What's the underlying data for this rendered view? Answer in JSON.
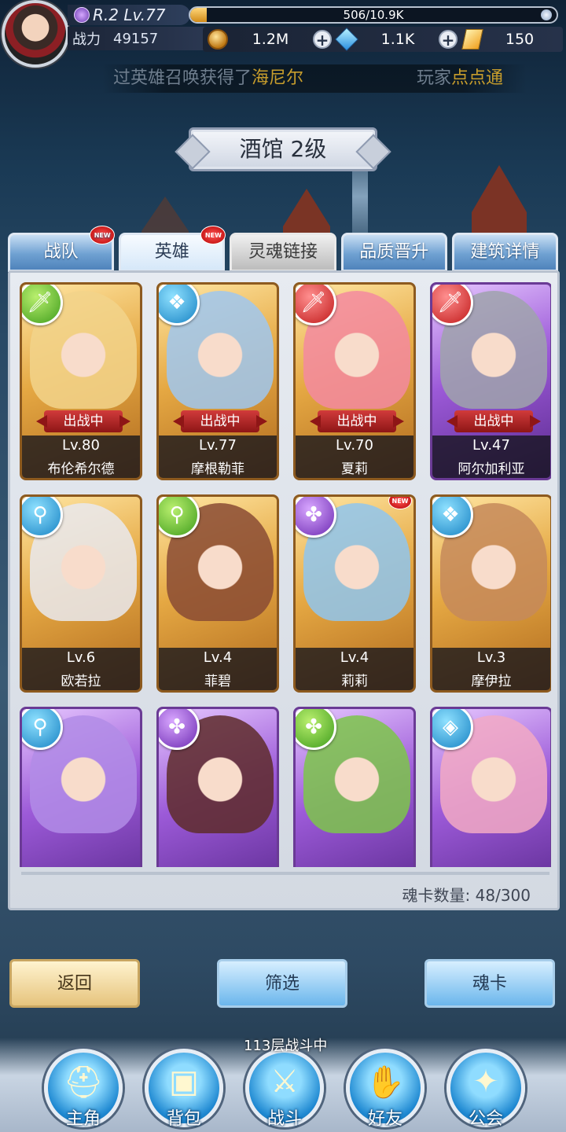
{
  "player": {
    "rank_level": "R.2 Lv.77",
    "exp": "506/10.9K",
    "exp_fraction": 0.046,
    "power_label": "战力",
    "power_value": "49157"
  },
  "resources": {
    "gold": "1.2M",
    "crystal": "1.1K",
    "ticket": "150"
  },
  "marquee": {
    "msg_a_prefix": "过英雄召唤获得了",
    "msg_a_hero": "海尼尔",
    "msg_b_prefix": "玩家",
    "msg_b_name": "点点通"
  },
  "title": "酒馆 2级",
  "tabs": [
    {
      "label": "战队",
      "new": "NEW"
    },
    {
      "label": "英雄",
      "new": "NEW"
    },
    {
      "label": "灵魂链接"
    },
    {
      "label": "品质晋升"
    },
    {
      "label": "建筑详情"
    }
  ],
  "deploy_label": "出战中",
  "heroes": [
    {
      "name": "布伦希尔德",
      "level": "Lv.80",
      "element": "green",
      "frame": "gold",
      "deployed": true,
      "hair": "#f2d38b",
      "glyph": "sword-icon"
    },
    {
      "name": "摩根勒菲",
      "level": "Lv.77",
      "element": "blue",
      "frame": "gold",
      "deployed": true,
      "hair": "#9fc7f0",
      "glyph": "wing-icon"
    },
    {
      "name": "夏莉",
      "level": "Lv.70",
      "element": "red",
      "frame": "gold",
      "deployed": true,
      "hair": "#f38aa0",
      "glyph": "sword-icon"
    },
    {
      "name": "阿尔加利亚",
      "level": "Lv.47",
      "element": "red",
      "frame": "purple",
      "deployed": true,
      "hair": "#9fa3ab",
      "glyph": "sword-icon"
    },
    {
      "name": "欧若拉",
      "level": "Lv.6",
      "element": "blue",
      "frame": "gold",
      "deployed": false,
      "hair": "#e9e9ef",
      "glyph": "staff-icon"
    },
    {
      "name": "菲碧",
      "level": "Lv.4",
      "element": "green",
      "frame": "gold",
      "deployed": false,
      "hair": "#8a4b34",
      "glyph": "staff-icon"
    },
    {
      "name": "莉莉",
      "level": "Lv.4",
      "element": "purple",
      "frame": "gold",
      "deployed": false,
      "hair": "#8fc6ee",
      "glyph": "shuriken-icon",
      "new": "NEW"
    },
    {
      "name": "摩伊拉",
      "level": "Lv.3",
      "element": "blue",
      "frame": "gold",
      "deployed": false,
      "hair": "#c58a5a",
      "glyph": "wing-icon"
    },
    {
      "name": "",
      "level": "",
      "element": "blue",
      "frame": "purple",
      "deployed": false,
      "hair": "#b18ce6",
      "glyph": "staff-icon"
    },
    {
      "name": "",
      "level": "",
      "element": "purple",
      "frame": "purple",
      "deployed": false,
      "hair": "#5e2c2a",
      "glyph": "shuriken-icon"
    },
    {
      "name": "",
      "level": "",
      "element": "green",
      "frame": "purple",
      "deployed": false,
      "hair": "#7dc64a",
      "glyph": "shuriken-icon"
    },
    {
      "name": "",
      "level": "",
      "element": "blue",
      "frame": "purple",
      "deployed": false,
      "hair": "#f2a9c4",
      "glyph": "shield-icon"
    }
  ],
  "card_count": "魂卡数量: 48/300",
  "buttons": {
    "back": "返回",
    "filter": "筛选",
    "soul_card": "魂卡"
  },
  "battle_status": "113层战斗中",
  "nav": [
    {
      "label": "主角",
      "icon": "helmet-icon"
    },
    {
      "label": "背包",
      "icon": "backpack-icon"
    },
    {
      "label": "战斗",
      "icon": "crossed-swords-icon"
    },
    {
      "label": "好友",
      "icon": "handshake-icon"
    },
    {
      "label": "公会",
      "icon": "guild-emblem-icon"
    }
  ]
}
